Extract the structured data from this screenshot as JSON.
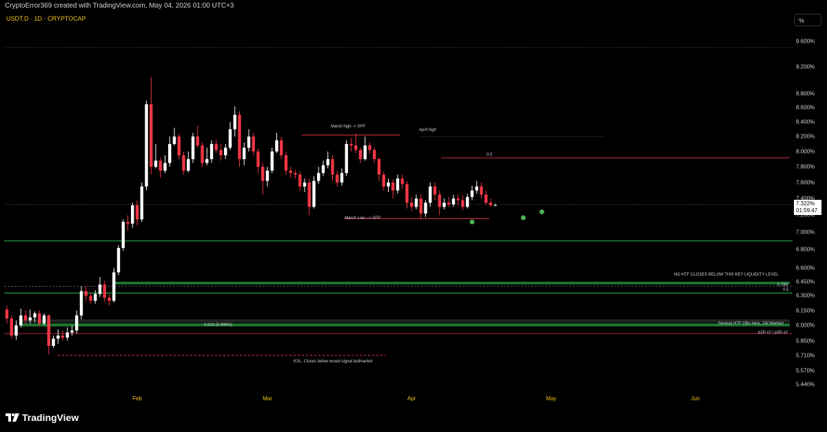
{
  "header": {
    "attribution": "CryptoError369 created with TradingView.com, May 04, 2026 01:00 UTC+3"
  },
  "chart_header": {
    "symbol": "USDT.D · 1D · CRYPTOCAP",
    "scale_button": "%"
  },
  "colors": {
    "up": "#ffffff",
    "down": "#f23645",
    "green_zone": "#1e8a3a",
    "accent_yellow": "#f0c419"
  },
  "chart_data": {
    "type": "candlestick",
    "yscale": "log",
    "ylim": [
      5.38,
      9.82
    ],
    "yticks": [
      "9.600%",
      "9.200%",
      "8.800%",
      "8.600%",
      "8.400%",
      "8.200%",
      "8.000%",
      "7.800%",
      "7.600%",
      "7.400%",
      "7.200%",
      "7.000%",
      "6.800%",
      "6.600%",
      "6.450%",
      "6.300%",
      "6.150%",
      "6.000%",
      "5.850%",
      "5.710%",
      "5.570%",
      "5.440%"
    ],
    "xtick_labels": [
      "Feb",
      "Mar",
      "Apr",
      "May",
      "Jun"
    ],
    "xtick_dates": [
      "2026-02-01",
      "2026-03-01",
      "2026-04-01",
      "2026-05-01",
      "2026-06-01"
    ],
    "first_candle_date": "2026-01-04",
    "last_price": "7.322%",
    "countdown": "01:59:47",
    "candles": [
      [
        6.16,
        6.07,
        6.2,
        6.02
      ],
      [
        6.07,
        5.9,
        6.1,
        5.87
      ],
      [
        5.9,
        6.0,
        6.05,
        5.86
      ],
      [
        6.0,
        6.1,
        6.17,
        5.98
      ],
      [
        6.1,
        6.05,
        6.15,
        6.01
      ],
      [
        6.05,
        6.08,
        6.16,
        6.02
      ],
      [
        6.08,
        6.12,
        6.14,
        6.03
      ],
      [
        6.12,
        6.02,
        6.15,
        5.99
      ],
      [
        6.02,
        6.1,
        6.12,
        6.0
      ],
      [
        6.1,
        5.8,
        6.11,
        5.72
      ],
      [
        5.8,
        5.87,
        5.9,
        5.78
      ],
      [
        5.87,
        5.9,
        5.96,
        5.82
      ],
      [
        5.9,
        5.88,
        5.95,
        5.85
      ],
      [
        5.88,
        5.93,
        5.98,
        5.85
      ],
      [
        5.93,
        5.95,
        6.0,
        5.9
      ],
      [
        5.95,
        6.1,
        6.15,
        5.92
      ],
      [
        6.1,
        6.35,
        6.4,
        6.06
      ],
      [
        6.35,
        6.3,
        6.4,
        6.25
      ],
      [
        6.3,
        6.25,
        6.34,
        6.22
      ],
      [
        6.25,
        6.32,
        6.36,
        6.22
      ],
      [
        6.32,
        6.42,
        6.5,
        6.29
      ],
      [
        6.42,
        6.28,
        6.46,
        6.24
      ],
      [
        6.28,
        6.25,
        6.32,
        6.2
      ],
      [
        6.25,
        6.55,
        6.6,
        6.23
      ],
      [
        6.55,
        6.82,
        6.85,
        6.52
      ],
      [
        6.82,
        7.12,
        7.15,
        6.79
      ],
      [
        7.12,
        7.1,
        7.2,
        7.02
      ],
      [
        7.1,
        7.32,
        7.35,
        7.05
      ],
      [
        7.32,
        7.15,
        7.38,
        7.08
      ],
      [
        7.15,
        7.55,
        7.6,
        7.12
      ],
      [
        7.55,
        8.65,
        8.7,
        7.5
      ],
      [
        8.65,
        7.8,
        9.05,
        7.7
      ],
      [
        7.8,
        7.88,
        8.1,
        7.78
      ],
      [
        7.88,
        7.75,
        7.92,
        7.66
      ],
      [
        7.75,
        7.85,
        7.95,
        7.72
      ],
      [
        7.85,
        8.1,
        8.2,
        7.8
      ],
      [
        8.1,
        8.2,
        8.32,
        8.08
      ],
      [
        8.2,
        7.95,
        8.24,
        7.9
      ],
      [
        7.95,
        7.75,
        8.0,
        7.7
      ],
      [
        7.75,
        7.9,
        8.0,
        7.73
      ],
      [
        7.9,
        8.2,
        8.25,
        7.85
      ],
      [
        8.2,
        8.08,
        8.35,
        8.05
      ],
      [
        8.08,
        7.85,
        8.12,
        7.8
      ],
      [
        7.85,
        7.9,
        8.05,
        7.82
      ],
      [
        7.9,
        8.1,
        8.15,
        7.85
      ],
      [
        8.1,
        8.02,
        8.16,
        7.98
      ],
      [
        8.02,
        7.95,
        8.1,
        7.88
      ],
      [
        7.95,
        8.05,
        8.1,
        7.9
      ],
      [
        8.05,
        8.3,
        8.4,
        8.02
      ],
      [
        8.3,
        8.5,
        8.62,
        8.2
      ],
      [
        8.5,
        7.9,
        8.55,
        7.8
      ],
      [
        7.9,
        8.05,
        8.12,
        7.82
      ],
      [
        8.05,
        8.2,
        8.3,
        8.0
      ],
      [
        8.2,
        8.0,
        8.25,
        7.95
      ],
      [
        8.0,
        7.8,
        8.04,
        7.72
      ],
      [
        7.8,
        7.62,
        7.85,
        7.45
      ],
      [
        7.62,
        7.75,
        7.8,
        7.55
      ],
      [
        7.75,
        8.0,
        8.05,
        7.72
      ],
      [
        8.0,
        8.15,
        8.25,
        7.98
      ],
      [
        8.15,
        7.95,
        8.2,
        7.9
      ],
      [
        7.95,
        7.75,
        8.0,
        7.7
      ],
      [
        7.75,
        7.72,
        7.8,
        7.66
      ],
      [
        7.72,
        7.7,
        7.76,
        7.65
      ],
      [
        7.7,
        7.55,
        7.74,
        7.5
      ],
      [
        7.55,
        7.6,
        7.65,
        7.48
      ],
      [
        7.6,
        7.3,
        7.65,
        7.2
      ],
      [
        7.3,
        7.62,
        7.68,
        7.28
      ],
      [
        7.62,
        7.72,
        7.8,
        7.58
      ],
      [
        7.72,
        7.82,
        7.88,
        7.68
      ],
      [
        7.82,
        7.9,
        8.0,
        7.78
      ],
      [
        7.9,
        7.7,
        7.95,
        7.62
      ],
      [
        7.7,
        7.6,
        7.75,
        7.55
      ],
      [
        7.6,
        7.72,
        7.78,
        7.56
      ],
      [
        7.72,
        8.1,
        8.15,
        7.68
      ],
      [
        8.1,
        8.08,
        8.18,
        8.0
      ],
      [
        8.08,
        8.02,
        8.24,
        7.98
      ],
      [
        8.02,
        7.9,
        8.05,
        7.85
      ],
      [
        7.9,
        8.08,
        8.2,
        7.88
      ],
      [
        8.08,
        8.02,
        8.12,
        7.97
      ],
      [
        8.02,
        7.9,
        8.05,
        7.85
      ],
      [
        7.9,
        7.7,
        7.92,
        7.62
      ],
      [
        7.7,
        7.55,
        7.74,
        7.5
      ],
      [
        7.55,
        7.6,
        7.65,
        7.48
      ],
      [
        7.6,
        7.5,
        7.64,
        7.4
      ],
      [
        7.5,
        7.65,
        7.7,
        7.46
      ],
      [
        7.65,
        7.58,
        7.7,
        7.52
      ],
      [
        7.58,
        7.35,
        7.62,
        7.28
      ],
      [
        7.35,
        7.3,
        7.42,
        7.25
      ],
      [
        7.3,
        7.4,
        7.45,
        7.27
      ],
      [
        7.4,
        7.22,
        7.46,
        7.15
      ],
      [
        7.22,
        7.35,
        7.38,
        7.18
      ],
      [
        7.35,
        7.55,
        7.6,
        7.3
      ],
      [
        7.55,
        7.45,
        7.6,
        7.38
      ],
      [
        7.45,
        7.3,
        7.5,
        7.2
      ],
      [
        7.3,
        7.35,
        7.4,
        7.27
      ],
      [
        7.35,
        7.33,
        7.42,
        7.3
      ],
      [
        7.33,
        7.4,
        7.45,
        7.3
      ],
      [
        7.4,
        7.38,
        7.45,
        7.32
      ],
      [
        7.38,
        7.3,
        7.44,
        7.26
      ],
      [
        7.3,
        7.42,
        7.46,
        7.28
      ],
      [
        7.42,
        7.5,
        7.56,
        7.38
      ],
      [
        7.5,
        7.55,
        7.62,
        7.46
      ],
      [
        7.55,
        7.45,
        7.6,
        7.4
      ],
      [
        7.45,
        7.35,
        7.5,
        7.32
      ],
      [
        7.35,
        7.32,
        7.4,
        7.3
      ],
      [
        7.32,
        7.32,
        7.34,
        7.31
      ]
    ],
    "annotations": [
      {
        "text": "March high -> SFP"
      },
      {
        "text": "April high"
      },
      {
        "text": "March Low  --> SFP"
      },
      {
        "text": "0.0"
      },
      {
        "text": "NO HTF CLOSES BELOW THIS KEY LIQUIDITY LEVEL"
      },
      {
        "text": "0.786"
      },
      {
        "text": "0.5"
      },
      {
        "text": "0.618 (5.998%)"
      },
      {
        "text": "Several HTF OBs here, 2W Marked"
      },
      {
        "text": "p2D x2 / p3D x2"
      },
      {
        "text": "KSL, Closes below would signal bullmarket"
      }
    ],
    "levels": [
      {
        "price": 9.5,
        "style": "dotted"
      },
      {
        "price": 6.9,
        "style": "green-line"
      },
      {
        "price": 6.42,
        "style": "green-zone",
        "high": 6.45
      },
      {
        "price": 6.4,
        "style": "dashed"
      },
      {
        "price": 6.33,
        "style": "green-line"
      },
      {
        "price": 6.03,
        "style": "gray-zone",
        "high": 6.06
      },
      {
        "price": 5.99,
        "style": "green-zone",
        "high": 6.02
      },
      {
        "price": 5.92,
        "style": "red-line"
      },
      {
        "price": 7.91,
        "style": "red-box",
        "high": 7.93
      },
      {
        "price": 8.2,
        "style": "dotted"
      },
      {
        "price": 7.33,
        "style": "price-line"
      }
    ],
    "markers": [
      {
        "date": "2026-04-14",
        "price": 7.12
      },
      {
        "date": "2026-04-25",
        "price": 7.17
      },
      {
        "date": "2026-04-29",
        "price": 7.24
      }
    ]
  },
  "footer": {
    "brand": "TradingView"
  }
}
